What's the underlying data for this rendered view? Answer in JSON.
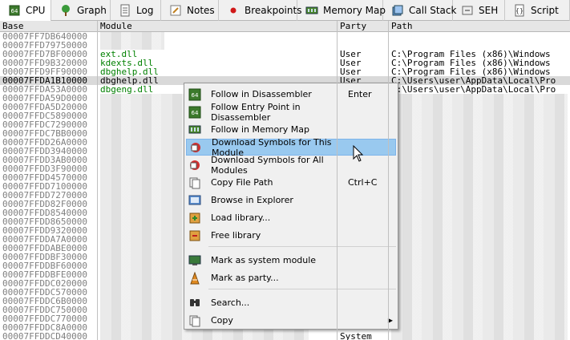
{
  "tabs": [
    {
      "label": "CPU",
      "icon": "cpu-icon"
    },
    {
      "label": "Graph",
      "icon": "graph-icon"
    },
    {
      "label": "Log",
      "icon": "log-icon"
    },
    {
      "label": "Notes",
      "icon": "notes-icon"
    },
    {
      "label": "Breakpoints",
      "icon": "breakpoint-icon"
    },
    {
      "label": "Memory Map",
      "icon": "memory-map-icon"
    },
    {
      "label": "Call Stack",
      "icon": "call-stack-icon"
    },
    {
      "label": "SEH",
      "icon": "seh-icon"
    },
    {
      "label": "Script",
      "icon": "script-icon"
    }
  ],
  "columns": {
    "base": "Base",
    "module": "Module",
    "party": "Party",
    "path": "Path"
  },
  "rows": [
    {
      "base": "00007FF7DB640000",
      "module": "",
      "party": "",
      "path": ""
    },
    {
      "base": "00007FFD79750000",
      "module": "",
      "party": "",
      "path": ""
    },
    {
      "base": "00007FFD7BF00000",
      "module": "ext.dll",
      "party": "User",
      "path": "C:\\Program Files (x86)\\Windows"
    },
    {
      "base": "00007FFD9B320000",
      "module": "kdexts.dll",
      "party": "User",
      "path": "C:\\Program Files (x86)\\Windows"
    },
    {
      "base": "00007FFD9FF90000",
      "module": "dbghelp.dll",
      "party": "User",
      "path": "C:\\Program Files (x86)\\Windows"
    },
    {
      "base": "00007FFDA1B10000",
      "module": "dbghelp.dll",
      "party": "User",
      "path": "C:\\Users\\user\\AppData\\Local\\Pro"
    },
    {
      "base": "00007FFDA53A0000",
      "module": "dbgeng.dll",
      "party": "",
      "path": "C:\\Users\\user\\AppData\\Local\\Pro"
    },
    {
      "base": "00007FFDA59D0000",
      "module": "",
      "party": "",
      "path": ""
    },
    {
      "base": "00007FFDA5D20000",
      "module": "",
      "party": "",
      "path": ""
    },
    {
      "base": "00007FFDC5890000",
      "module": "",
      "party": "",
      "path": ""
    },
    {
      "base": "00007FFDC7290000",
      "module": "",
      "party": "",
      "path": ""
    },
    {
      "base": "00007FFDC7BB0000",
      "module": "",
      "party": "",
      "path": ""
    },
    {
      "base": "00007FFDD26A0000",
      "module": "",
      "party": "",
      "path": ""
    },
    {
      "base": "00007FFDD3940000",
      "module": "",
      "party": "",
      "path": ""
    },
    {
      "base": "00007FFDD3AB0000",
      "module": "",
      "party": "",
      "path": ""
    },
    {
      "base": "00007FFDD3F90000",
      "module": "",
      "party": "",
      "path": ""
    },
    {
      "base": "00007FFDD4570000",
      "module": "",
      "party": "",
      "path": ""
    },
    {
      "base": "00007FFDD7100000",
      "module": "",
      "party": "",
      "path": ""
    },
    {
      "base": "00007FFDD7270000",
      "module": "",
      "party": "",
      "path": ""
    },
    {
      "base": "00007FFDD82F0000",
      "module": "",
      "party": "",
      "path": ""
    },
    {
      "base": "00007FFDD8540000",
      "module": "",
      "party": "",
      "path": ""
    },
    {
      "base": "00007FFDD8650000",
      "module": "",
      "party": "",
      "path": ""
    },
    {
      "base": "00007FFDD9320000",
      "module": "",
      "party": "",
      "path": ""
    },
    {
      "base": "00007FFDDA7A0000",
      "module": "",
      "party": "",
      "path": ""
    },
    {
      "base": "00007FFDDABE0000",
      "module": "",
      "party": "",
      "path": ""
    },
    {
      "base": "00007FFDDBF30000",
      "module": "",
      "party": "",
      "path": ""
    },
    {
      "base": "00007FFDDBF60000",
      "module": "",
      "party": "",
      "path": ""
    },
    {
      "base": "00007FFDDBFE0000",
      "module": "",
      "party": "",
      "path": ""
    },
    {
      "base": "00007FFDDC020000",
      "module": "",
      "party": "",
      "path": ""
    },
    {
      "base": "00007FFDDC570000",
      "module": "",
      "party": "",
      "path": ""
    },
    {
      "base": "00007FFDDC6B0000",
      "module": "",
      "party": "",
      "path": ""
    },
    {
      "base": "00007FFDDC750000",
      "module": "",
      "party": "",
      "path": ""
    },
    {
      "base": "00007FFDDC770000",
      "module": "",
      "party": "",
      "path": ""
    },
    {
      "base": "00007FFDDC8A0000",
      "module": "",
      "party": "",
      "path": ""
    },
    {
      "base": "00007FFDDCD40000",
      "module": "",
      "party": "System",
      "path": ""
    }
  ],
  "context_menu": [
    {
      "label": "Follow in Disassembler",
      "shortcut": "Enter",
      "icon": "disassembler-icon"
    },
    {
      "label": "Follow Entry Point in Disassembler",
      "shortcut": "",
      "icon": "entry-point-icon"
    },
    {
      "label": "Follow in Memory Map",
      "shortcut": "",
      "icon": "memory-map-icon"
    },
    {
      "label": "Download Symbols for This Module",
      "shortcut": "",
      "icon": "download-symbols-icon"
    },
    {
      "label": "Download Symbols for All Modules",
      "shortcut": "",
      "icon": "download-all-symbols-icon"
    },
    {
      "label": "Copy File Path",
      "shortcut": "Ctrl+C",
      "icon": "copy-icon"
    },
    {
      "label": "Browse in Explorer",
      "shortcut": "",
      "icon": "explorer-icon"
    },
    {
      "label": "Load library...",
      "shortcut": "",
      "icon": "load-library-icon"
    },
    {
      "label": "Free library",
      "shortcut": "",
      "icon": "free-library-icon"
    },
    {
      "label": "Mark as system module",
      "shortcut": "",
      "icon": "system-module-icon"
    },
    {
      "label": "Mark as party...",
      "shortcut": "",
      "icon": "party-icon"
    },
    {
      "label": "Search...",
      "shortcut": "",
      "icon": "search-icon"
    },
    {
      "label": "Copy",
      "shortcut": "",
      "icon": "copy-icon",
      "submenu": "▶"
    }
  ],
  "colors": {
    "module_green": "#008000",
    "highlight": "#99c9ef",
    "selected_row": "#d9d9d9"
  }
}
